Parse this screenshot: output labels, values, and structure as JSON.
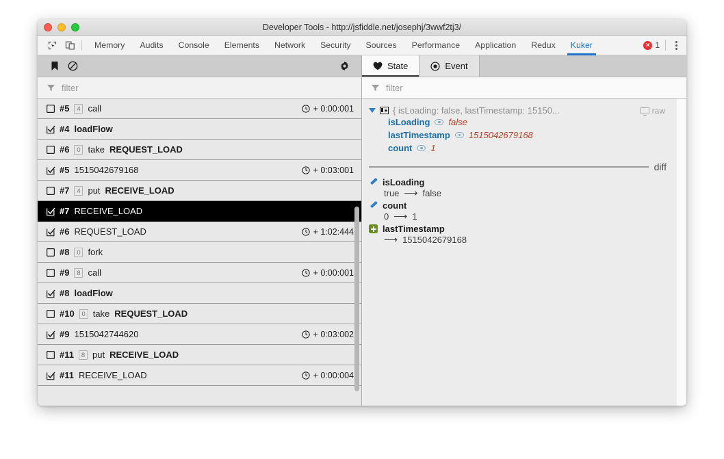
{
  "window": {
    "title": "Developer Tools - http://jsfiddle.net/josephj/3wwf2tj3/",
    "traffic_lights": [
      "close",
      "minimize",
      "maximize"
    ]
  },
  "devtools": {
    "icons": [
      "inspect-element-icon",
      "device-toolbar-icon"
    ],
    "tabs": [
      {
        "label": "Memory",
        "active": false
      },
      {
        "label": "Audits",
        "active": false
      },
      {
        "label": "Console",
        "active": false
      },
      {
        "label": "Elements",
        "active": false
      },
      {
        "label": "Network",
        "active": false
      },
      {
        "label": "Security",
        "active": false
      },
      {
        "label": "Sources",
        "active": false
      },
      {
        "label": "Performance",
        "active": false
      },
      {
        "label": "Application",
        "active": false
      },
      {
        "label": "Redux",
        "active": false
      },
      {
        "label": "Kuker",
        "active": true
      }
    ],
    "error_count": "1",
    "error_glyph": "×",
    "accent_color": "#1a73c8",
    "error_color": "#e3342f"
  },
  "left_panel": {
    "toolbar": {
      "bookmark_label": "bookmark-icon",
      "clear_label": "clear-icon",
      "settings_label": "gear-icon"
    },
    "filter": {
      "placeholder": "filter",
      "value": ""
    },
    "rows": [
      {
        "checked": false,
        "id": "#5",
        "badge": "4",
        "prefix": "",
        "label": "call",
        "bold": false,
        "time": "+ 0:00:001",
        "selected": false
      },
      {
        "checked": true,
        "id": "#4",
        "badge": "",
        "prefix": "",
        "label": "loadFlow",
        "bold": true,
        "time": "",
        "selected": false
      },
      {
        "checked": false,
        "id": "#6",
        "badge": "0",
        "prefix": "take",
        "label": "REQUEST_LOAD",
        "bold": true,
        "time": "",
        "selected": false
      },
      {
        "checked": true,
        "id": "#5",
        "badge": "",
        "prefix": "",
        "label": "1515042679168",
        "bold": false,
        "time": "+ 0:03:001",
        "selected": false
      },
      {
        "checked": false,
        "id": "#7",
        "badge": "4",
        "prefix": "put",
        "label": "RECEIVE_LOAD",
        "bold": true,
        "time": "",
        "selected": false
      },
      {
        "checked": true,
        "id": "#7",
        "badge": "",
        "prefix": "",
        "label": "RECEIVE_LOAD",
        "bold": false,
        "time": "",
        "selected": true
      },
      {
        "checked": true,
        "id": "#6",
        "badge": "",
        "prefix": "",
        "label": "REQUEST_LOAD",
        "bold": false,
        "time": "+ 1:02:444",
        "selected": false
      },
      {
        "checked": false,
        "id": "#8",
        "badge": "0",
        "prefix": "",
        "label": "fork",
        "bold": false,
        "time": "",
        "selected": false
      },
      {
        "checked": false,
        "id": "#9",
        "badge": "8",
        "prefix": "",
        "label": "call",
        "bold": false,
        "time": "+ 0:00:001",
        "selected": false
      },
      {
        "checked": true,
        "id": "#8",
        "badge": "",
        "prefix": "",
        "label": "loadFlow",
        "bold": true,
        "time": "",
        "selected": false
      },
      {
        "checked": false,
        "id": "#10",
        "badge": "0",
        "prefix": "take",
        "label": "REQUEST_LOAD",
        "bold": true,
        "time": "",
        "selected": false
      },
      {
        "checked": true,
        "id": "#9",
        "badge": "",
        "prefix": "",
        "label": "1515042744620",
        "bold": false,
        "time": "+ 0:03:002",
        "selected": false
      },
      {
        "checked": false,
        "id": "#11",
        "badge": "8",
        "prefix": "put",
        "label": "RECEIVE_LOAD",
        "bold": true,
        "time": "",
        "selected": false
      },
      {
        "checked": true,
        "id": "#11",
        "badge": "",
        "prefix": "",
        "label": "RECEIVE_LOAD",
        "bold": false,
        "time": "+ 0:00:004",
        "selected": false
      }
    ]
  },
  "right_panel": {
    "tabs": [
      {
        "label": "State",
        "icon": "heart-icon",
        "active": true
      },
      {
        "label": "Event",
        "icon": "record-icon",
        "active": false
      }
    ],
    "filter": {
      "placeholder": "filter",
      "value": ""
    },
    "tree": {
      "summary": "{ isLoading: false, lastTimestamp: 15150...",
      "raw_label": "raw",
      "properties": [
        {
          "key": "isLoading",
          "value": "false"
        },
        {
          "key": "lastTimestamp",
          "value": "1515042679168"
        },
        {
          "key": "count",
          "value": "1"
        }
      ]
    },
    "diff": {
      "label": "diff",
      "entries": [
        {
          "type": "edit",
          "name": "isLoading",
          "from": "true",
          "arrow": "⟶",
          "to": "false"
        },
        {
          "type": "edit",
          "name": "count",
          "from": "0",
          "arrow": "⟶",
          "to": "1"
        },
        {
          "type": "add",
          "name": "lastTimestamp",
          "from": "",
          "arrow": "⟶",
          "to": "1515042679168"
        }
      ]
    },
    "colors": {
      "key": "#1a6fa8",
      "value": "#b5412b",
      "add": "#6b8e23",
      "edit": "#2f7fc4"
    }
  }
}
